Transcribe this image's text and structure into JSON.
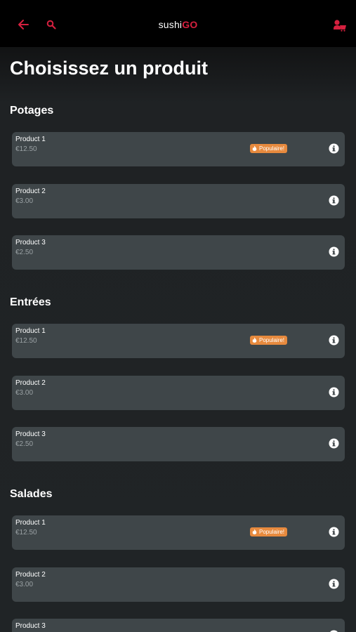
{
  "header": {
    "logo_part1": "sushi",
    "logo_part2": "GO",
    "accent_color": "#d6203f",
    "icons": [
      "back-arrow-icon",
      "search-icon",
      "cart-icon"
    ]
  },
  "page_title": "Choisissez un produit",
  "badge_label": "Populaire!",
  "sections": [
    {
      "title": "Potages",
      "products": [
        {
          "name": "Product 1",
          "price": "€12.50",
          "popular": true
        },
        {
          "name": "Product 2",
          "price": "€3.00",
          "popular": false
        },
        {
          "name": "Product 3",
          "price": "€2.50",
          "popular": false
        }
      ]
    },
    {
      "title": "Entrées",
      "products": [
        {
          "name": "Product 1",
          "price": "€12.50",
          "popular": true
        },
        {
          "name": "Product 2",
          "price": "€3.00",
          "popular": false
        },
        {
          "name": "Product 3",
          "price": "€2.50",
          "popular": false
        }
      ]
    },
    {
      "title": "Salades",
      "products": [
        {
          "name": "Product 1",
          "price": "€12.50",
          "popular": true
        },
        {
          "name": "Product 2",
          "price": "€3.00",
          "popular": false
        },
        {
          "name": "Product 3",
          "price": "",
          "popular": false
        }
      ]
    }
  ]
}
